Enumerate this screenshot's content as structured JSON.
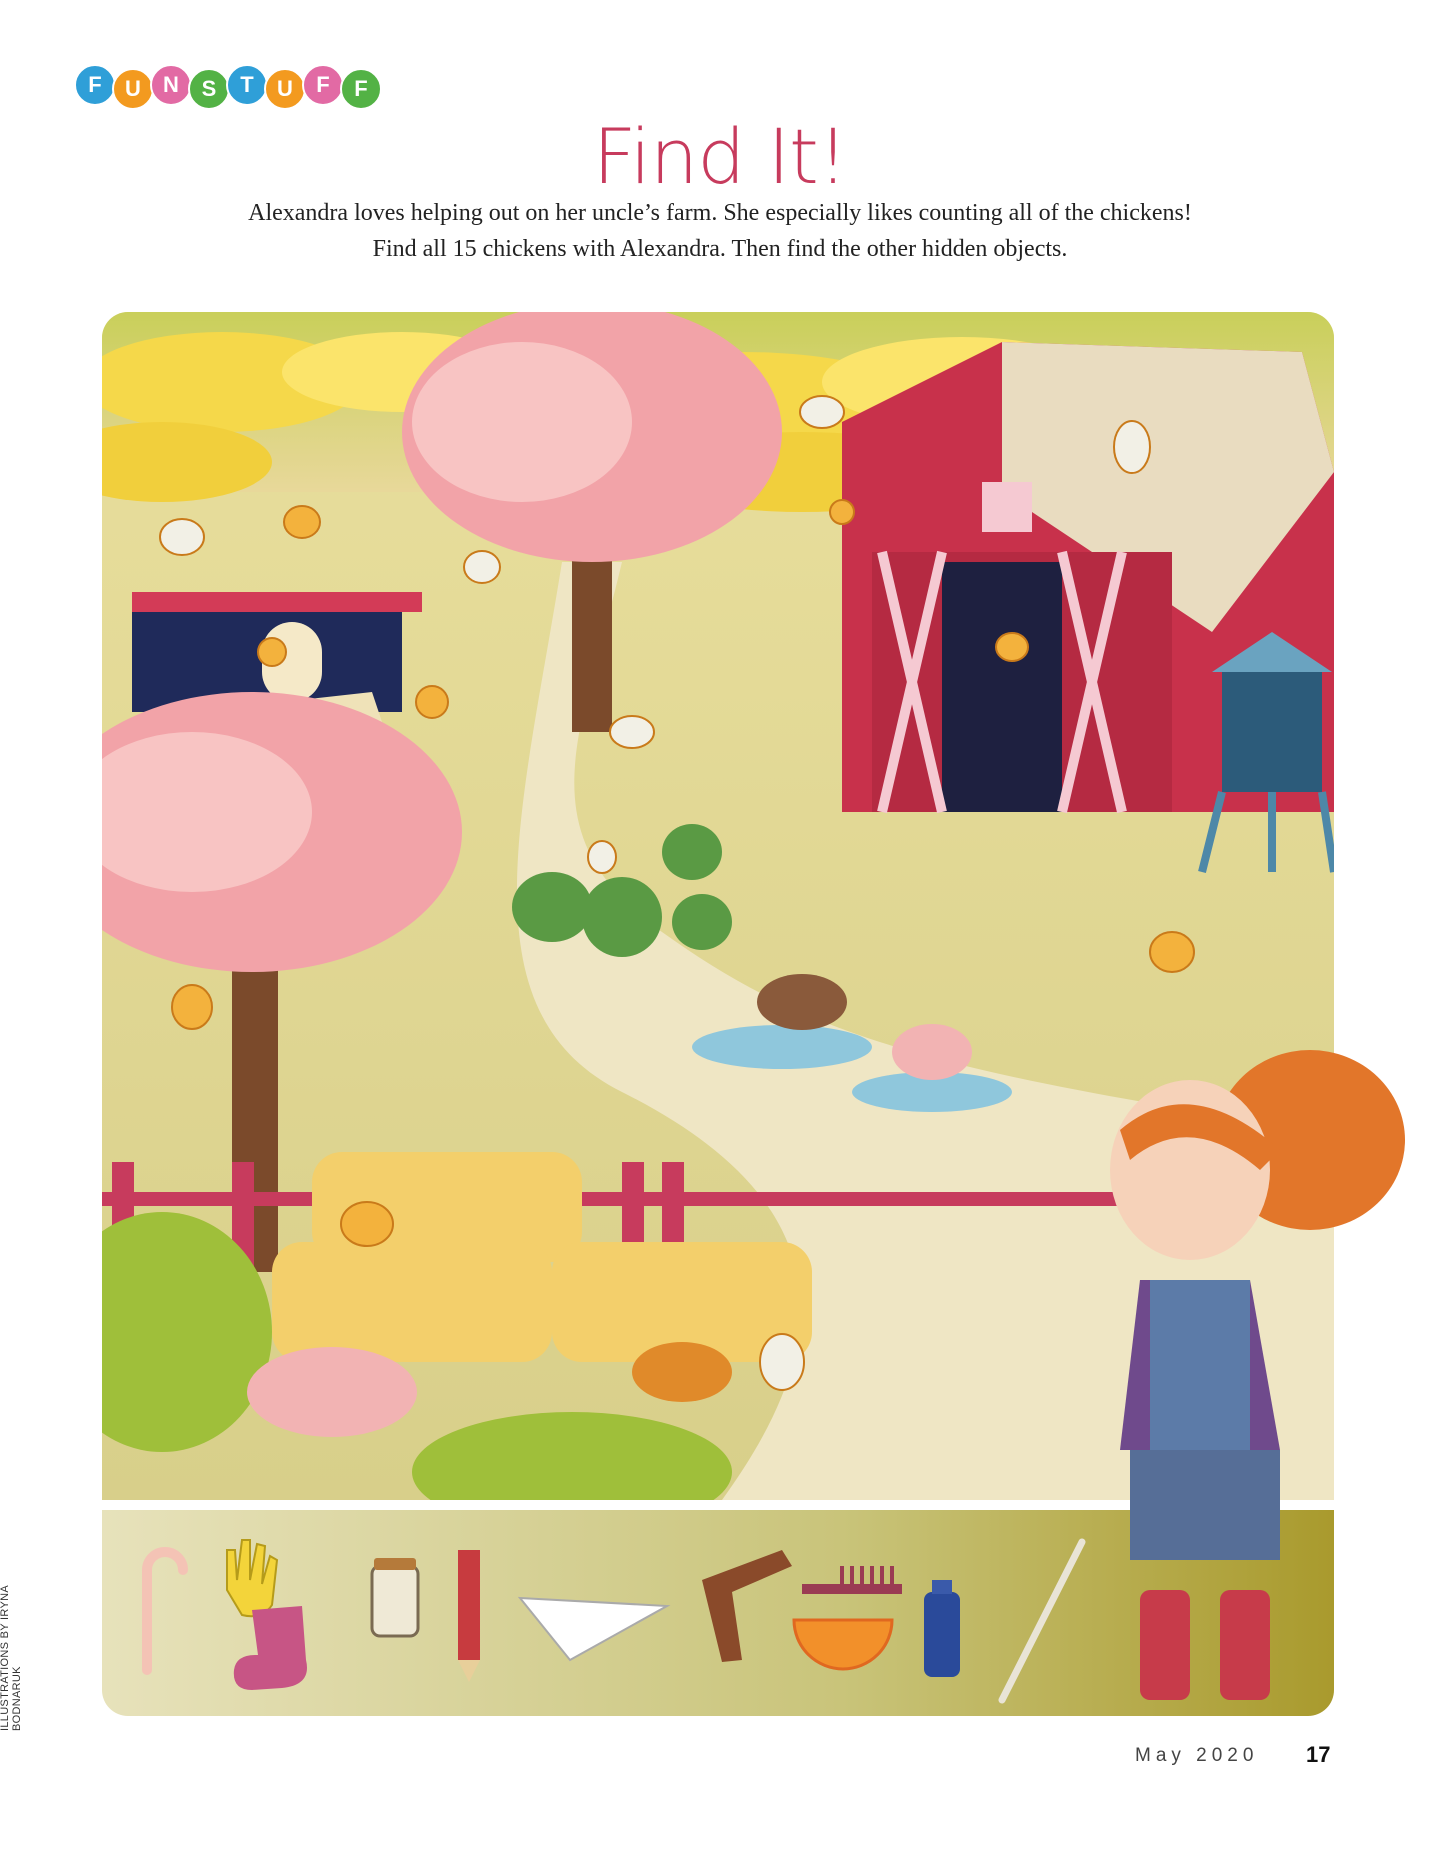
{
  "brand": {
    "letters": [
      "F",
      "U",
      "N",
      "S",
      "T",
      "U",
      "F",
      "F"
    ],
    "colors": [
      "#2f9fd8",
      "#f39a1f",
      "#e26aa4",
      "#53b245",
      "#2f9fd8",
      "#f39a1f",
      "#e26aa4",
      "#53b245"
    ]
  },
  "title": "Find It!",
  "intro": {
    "line1": "Alexandra loves helping out on her uncle’s farm. She especially likes counting all of the chickens!",
    "line2": "Find all 15 chickens with Alexandra. Then find the other hidden objects."
  },
  "hidden_objects": [
    {
      "icon": "candy-cane-icon"
    },
    {
      "icon": "glove-icon"
    },
    {
      "icon": "sock-icon"
    },
    {
      "icon": "jar-icon"
    },
    {
      "icon": "pencil-icon"
    },
    {
      "icon": "paper-airplane-icon"
    },
    {
      "icon": "boomerang-icon"
    },
    {
      "icon": "comb-icon"
    },
    {
      "icon": "orange-slice-icon"
    },
    {
      "icon": "baby-bottle-icon"
    },
    {
      "icon": "knitting-needle-icon"
    }
  ],
  "credit": "ILLUSTRATIONS BY IRYNA BODNARUK",
  "footer": {
    "month": "May 2020",
    "page": "17"
  }
}
